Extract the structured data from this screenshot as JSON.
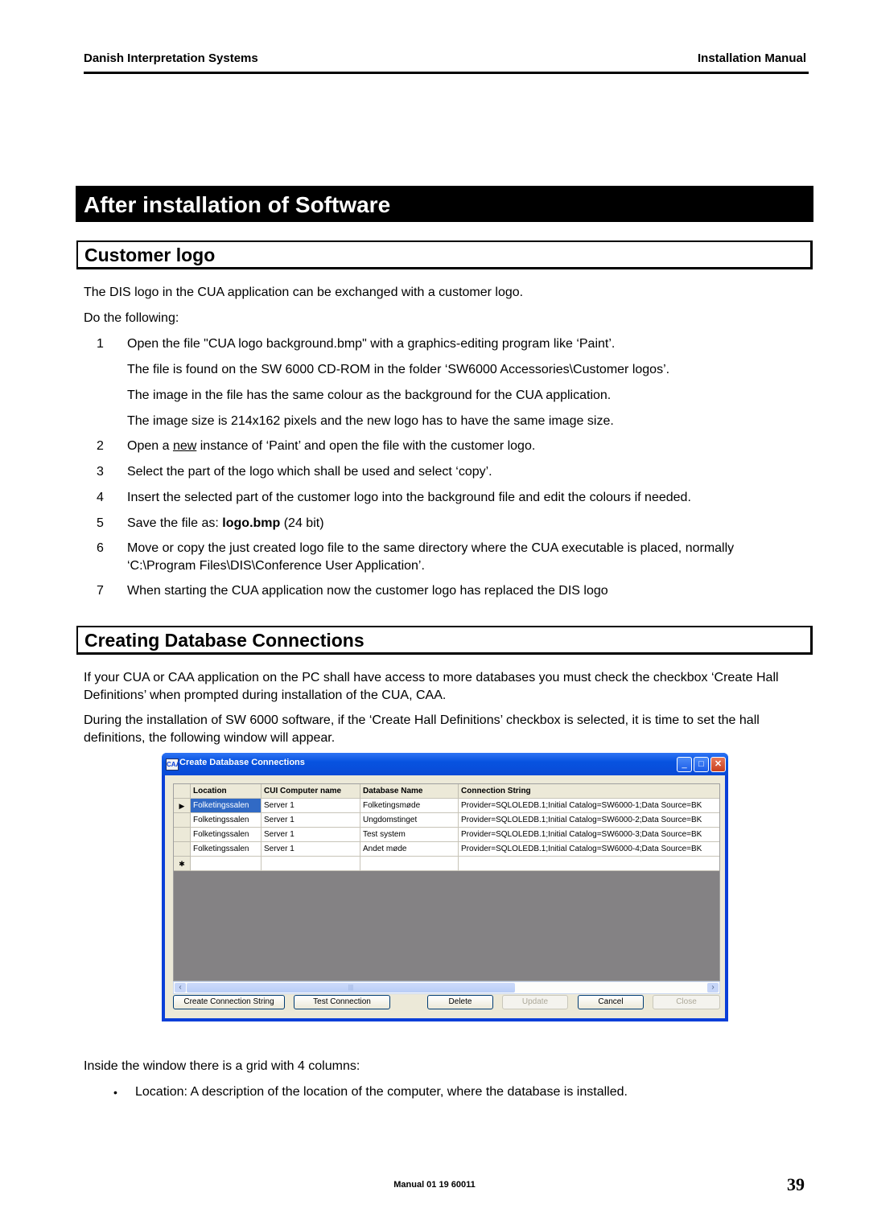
{
  "header": {
    "left": "Danish Interpretation Systems",
    "right": "Installation Manual"
  },
  "chapter_title": "After installation of Software",
  "section_customer_logo": {
    "title": "Customer logo",
    "intro": "The DIS logo in the CUA application can be exchanged with a customer logo.",
    "do_following": "Do the following:",
    "steps": [
      {
        "num": "1",
        "text": "Open the file \"CUA logo background.bmp\" with a graphics-editing program like ‘Paint’."
      },
      {
        "num": "",
        "text": "The file is found on the SW 6000 CD-ROM in the folder ‘SW6000 Accessories\\Customer logos’."
      },
      {
        "num": "",
        "text": "The image in the file has the same colour as the background for the CUA application."
      },
      {
        "num": "",
        "text": "The image size is 214x162 pixels and the new logo has to have the same image size."
      },
      {
        "num": "2",
        "pre": "Open a ",
        "underlined": "new",
        "post": " instance of ‘Paint’ and open the file with the customer logo."
      },
      {
        "num": "3",
        "text": "Select the part of the logo which shall be used and select ‘copy’."
      },
      {
        "num": "4",
        "text": "Insert the selected part of the customer logo into the background file and edit the colours if needed."
      },
      {
        "num": "5",
        "pre": "Save the file as: ",
        "bold": "logo.bmp",
        "post": " (24 bit)"
      },
      {
        "num": "6",
        "text": "Move or copy the just created logo file to the same directory where the CUA executable is placed, normally ‘C:\\Program Files\\DIS\\Conference User Application’."
      },
      {
        "num": "7",
        "text": "When starting the CUA application now the customer logo has replaced the DIS logo"
      }
    ]
  },
  "section_db": {
    "title": "Creating Database Connections",
    "para1": "If your CUA or CAA application on the PC shall have access to more databases you must check the checkbox ‘Create Hall Definitions’ when prompted during installation of the CUA, CAA.",
    "para2": "During the installation of SW 6000 software, if the ‘Create Hall Definitions’ checkbox is selected, it is time to set the hall definitions, the following window will appear.",
    "after_window": "Inside the window there is a grid with 4 columns:",
    "bullets": [
      "Location: A description of the location of the computer, where the database is installed."
    ]
  },
  "dialog": {
    "app_icon": "CAA",
    "title": "Create Database Connections",
    "window_buttons": {
      "minimize": "_",
      "maximize": "□",
      "close": "✕"
    },
    "columns": [
      "Location",
      "CUI Computer name",
      "Database Name",
      "Connection String"
    ],
    "rows": [
      [
        "Folketingssalen",
        "Server 1",
        "Folketingsmøde",
        "Provider=SQLOLEDB.1;Initial Catalog=SW6000-1;Data Source=BK"
      ],
      [
        "Folketingssalen",
        "Server 1",
        "Ungdomstinget",
        "Provider=SQLOLEDB.1;Initial Catalog=SW6000-2;Data Source=BK"
      ],
      [
        "Folketingssalen",
        "Server 1",
        "Test system",
        "Provider=SQLOLEDB.1;Initial Catalog=SW6000-3;Data Source=BK"
      ],
      [
        "Folketingssalen",
        "Server 1",
        "Andet møde",
        "Provider=SQLOLEDB.1;Initial Catalog=SW6000-4;Data Source=BK"
      ]
    ],
    "current_row_marker": "▶",
    "new_row_marker": "✱",
    "scroll_left": "‹",
    "scroll_right": "›",
    "scroll_grip": "|||",
    "buttons": {
      "create_connection_string": "Create Connection String",
      "test_connection": "Test Connection",
      "delete": "Delete",
      "update": "Update",
      "cancel": "Cancel",
      "close": "Close"
    }
  },
  "footer": {
    "code": "Manual 01 19 60011",
    "page_number": "39"
  }
}
